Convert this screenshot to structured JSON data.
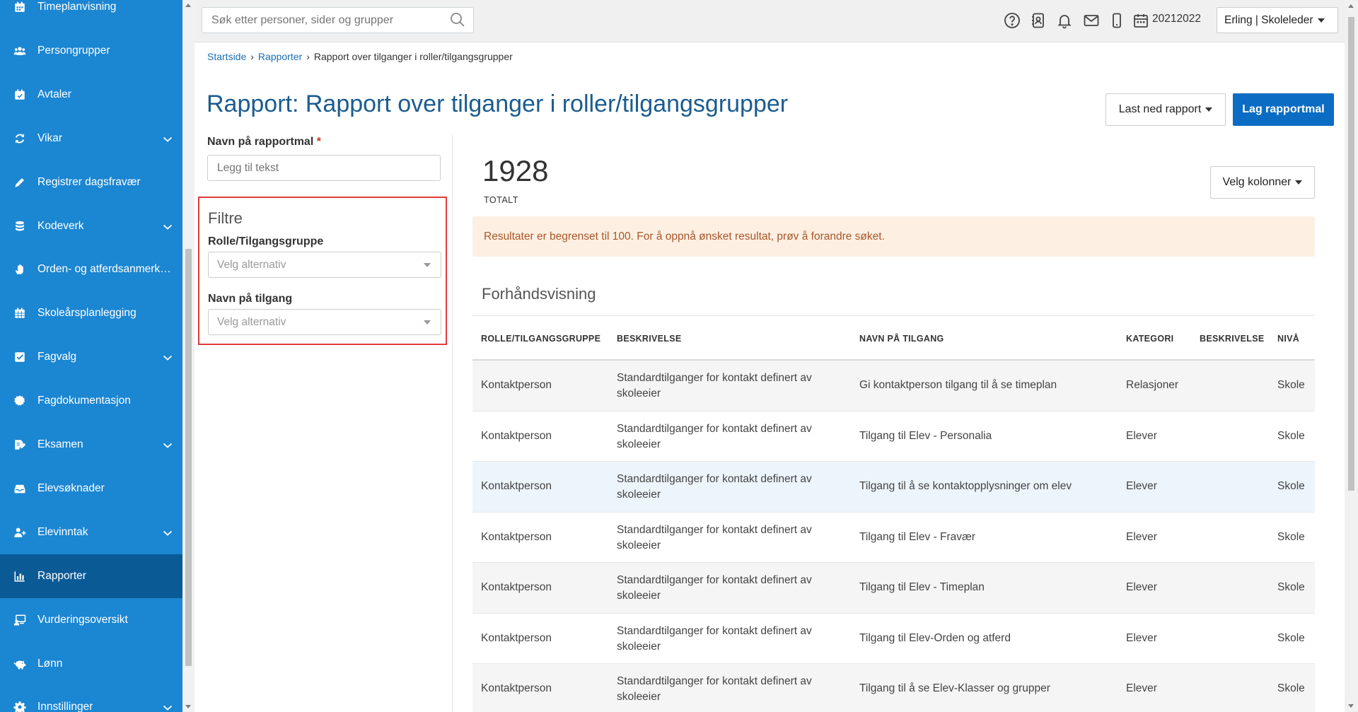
{
  "sidebar": {
    "items": [
      {
        "label": "Timeplanvisning",
        "icon": "calendar-icon",
        "chevron": false,
        "active": false
      },
      {
        "label": "Persongrupper",
        "icon": "users-icon",
        "chevron": false,
        "active": false
      },
      {
        "label": "Avtaler",
        "icon": "calendar-check-icon",
        "chevron": false,
        "active": false
      },
      {
        "label": "Vikar",
        "icon": "sync-icon",
        "chevron": true,
        "active": false
      },
      {
        "label": "Registrer dagsfravær",
        "icon": "pencil-icon",
        "chevron": false,
        "active": false
      },
      {
        "label": "Kodeverk",
        "icon": "database-icon",
        "chevron": true,
        "active": false
      },
      {
        "label": "Orden- og atferdsanmerkn...",
        "icon": "hand-icon",
        "chevron": false,
        "active": false
      },
      {
        "label": "Skoleårsplanlegging",
        "icon": "calendar-grid-icon",
        "chevron": false,
        "active": false
      },
      {
        "label": "Fagvalg",
        "icon": "checkbox-icon",
        "chevron": true,
        "active": false
      },
      {
        "label": "Fagdokumentasjon",
        "icon": "badge-icon",
        "chevron": false,
        "active": false
      },
      {
        "label": "Eksamen",
        "icon": "edit-document-icon",
        "chevron": true,
        "active": false
      },
      {
        "label": "Elevsøknader",
        "icon": "inbox-icon",
        "chevron": false,
        "active": false
      },
      {
        "label": "Elevinntak",
        "icon": "user-plus-icon",
        "chevron": true,
        "active": false
      },
      {
        "label": "Rapporter",
        "icon": "bar-chart-icon",
        "chevron": false,
        "active": true
      },
      {
        "label": "Vurderingsoversikt",
        "icon": "screen-user-icon",
        "chevron": false,
        "active": false
      },
      {
        "label": "Lønn",
        "icon": "piggy-bank-icon",
        "chevron": false,
        "active": false
      },
      {
        "label": "Innstillinger",
        "icon": "gear-icon",
        "chevron": true,
        "active": false
      }
    ]
  },
  "topbar": {
    "search_placeholder": "Søk etter personer, sider og grupper",
    "school_year": "20212022",
    "user_label": "Erling | Skoleleder"
  },
  "breadcrumb": {
    "items": [
      "Startside",
      "Rapporter"
    ],
    "current": "Rapport over tilganger i roller/tilgangsgrupper"
  },
  "page": {
    "title": "Rapport: Rapport over tilganger i roller/tilgangsgrupper",
    "download_label": "Last ned rapport",
    "create_label": "Lag rapportmal"
  },
  "form": {
    "name_label": "Navn på rapportmal",
    "required_mark": "*",
    "name_placeholder": "Legg til tekst",
    "filters_title": "Filtre",
    "role_label": "Rolle/Tilgangsgruppe",
    "role_placeholder": "Velg alternativ",
    "access_label": "Navn på tilgang",
    "access_placeholder": "Velg alternativ"
  },
  "results": {
    "total": "1928",
    "total_label": "TOTALT",
    "columns_label": "Velg kolonner",
    "alert": "Resultater er begrenset til 100. For å oppnå ønsket resultat, prøv å forandre søket.",
    "preview_title": "Forhåndsvisning"
  },
  "table": {
    "headers": [
      "ROLLE/TILGANGSGRUPPE",
      "BESKRIVELSE",
      "NAVN PÅ TILGANG",
      "KATEGORI",
      "BESKRIVELSE",
      "NIVÅ"
    ],
    "rows": [
      [
        "Kontaktperson",
        "Standardtilganger for kontakt definert av skoleeier",
        "Gi kontaktperson tilgang til å se timeplan",
        "Relasjoner",
        "",
        "Skole"
      ],
      [
        "Kontaktperson",
        "Standardtilganger for kontakt definert av skoleeier",
        "Tilgang til Elev - Personalia",
        "Elever",
        "",
        "Skole"
      ],
      [
        "Kontaktperson",
        "Standardtilganger for kontakt definert av skoleeier",
        "Tilgang til å se kontaktopplysninger om elev",
        "Elever",
        "",
        "Skole"
      ],
      [
        "Kontaktperson",
        "Standardtilganger for kontakt definert av skoleeier",
        "Tilgang til Elev - Fravær",
        "Elever",
        "",
        "Skole"
      ],
      [
        "Kontaktperson",
        "Standardtilganger for kontakt definert av skoleeier",
        "Tilgang til Elev - Timeplan",
        "Elever",
        "",
        "Skole"
      ],
      [
        "Kontaktperson",
        "Standardtilganger for kontakt definert av skoleeier",
        "Tilgang til Elev-Orden og atferd",
        "Elever",
        "",
        "Skole"
      ],
      [
        "Kontaktperson",
        "Standardtilganger for kontakt definert av skoleeier",
        "Tilgang til å se Elev-Klasser og grupper",
        "Elever",
        "",
        "Skole"
      ]
    ]
  },
  "colors": {
    "sidebar": "#1b86d2",
    "sidebar_active": "#0a5a96",
    "primary_button": "#0b6cc3",
    "title": "#1b5c8f",
    "alert_bg": "#fdf0e2",
    "alert_text": "#a9562a",
    "highlight_border": "#e03b3b"
  }
}
